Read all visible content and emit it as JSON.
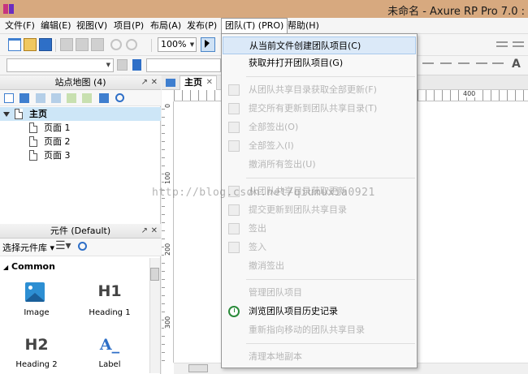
{
  "window": {
    "title": "未命名 - Axure RP Pro 7.0 :"
  },
  "menubar": {
    "items": [
      "文件(F)",
      "编辑(E)",
      "视图(V)",
      "项目(P)",
      "布局(A)",
      "发布(P)",
      "团队(T) (PRO)",
      "帮助(H)"
    ]
  },
  "toolbar": {
    "zoom": "100%"
  },
  "sitemap": {
    "title": "站点地图 (4)",
    "root": "主页",
    "pages": [
      "页面 1",
      "页面 2",
      "页面 3"
    ]
  },
  "widgets": {
    "title": "元件 (Default)",
    "library_label": "选择元件库",
    "section": "Common",
    "items": [
      {
        "label": "Image",
        "icon": "image-icon",
        "glyph": ""
      },
      {
        "label": "Heading 1",
        "icon": "heading1-icon",
        "glyph": "H1"
      },
      {
        "label": "Heading 2",
        "icon": "heading2-icon",
        "glyph": "H2"
      },
      {
        "label": "Label",
        "icon": "label-icon",
        "glyph": "A_"
      }
    ]
  },
  "document": {
    "tab": "主页",
    "ruler_marks": {
      "h": [
        "400"
      ],
      "v": [
        "0",
        "100",
        "200",
        "300"
      ]
    }
  },
  "team_menu": {
    "items": [
      {
        "label": "从当前文件创建团队项目(C)",
        "enabled": true,
        "highlighted": true
      },
      {
        "label": "获取并打开团队项目(G)",
        "enabled": true
      },
      {
        "label": "从团队共享目录获取全部更新(F)",
        "enabled": false
      },
      {
        "label": "提交所有更新到团队共享目录(T)",
        "enabled": false
      },
      {
        "label": "全部签出(O)",
        "enabled": false
      },
      {
        "label": "全部签入(I)",
        "enabled": false
      },
      {
        "label": "撤消所有签出(U)",
        "enabled": false
      },
      {
        "label": "从团队共享目录获取更新",
        "enabled": false
      },
      {
        "label": "提交更新到团队共享目录",
        "enabled": false
      },
      {
        "label": "签出",
        "enabled": false
      },
      {
        "label": "签入",
        "enabled": false
      },
      {
        "label": "撤消签出",
        "enabled": false
      },
      {
        "label": "管理团队项目",
        "enabled": false
      },
      {
        "label": "浏览团队项目历史记录",
        "enabled": true
      },
      {
        "label": "重新指向移动的团队共享目录",
        "enabled": false
      },
      {
        "label": "清理本地副本",
        "enabled": false
      }
    ]
  },
  "watermark": "http://blog.csdn.net/qiumuxia0921",
  "colors": {
    "titlebar": "#d7a97f",
    "highlight": "#dbe9f8",
    "selected_tree": "#cde6f7"
  }
}
